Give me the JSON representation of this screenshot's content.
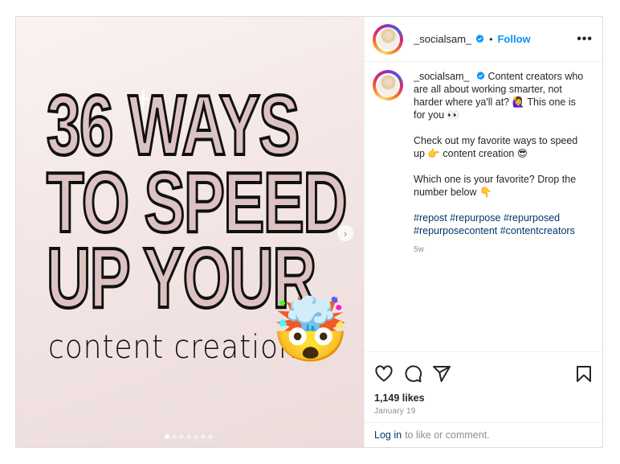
{
  "post": {
    "username": "_socialsam_",
    "verified": true,
    "separator": "•",
    "follow_label": "Follow",
    "more_label": "•••",
    "accent_color": "#0095f6",
    "hashtag_color": "#00376b"
  },
  "media": {
    "poster_lines": [
      "36 WAYS",
      "TO SPEED",
      "UP YOUR"
    ],
    "poster_script": "content creation",
    "poster_emoji": "🤯",
    "next_label": "›",
    "slide_count": 7,
    "active_slide": 1
  },
  "caption": {
    "username": "_socialsam_",
    "paragraphs": [
      "Content creators who are all about working smarter, not harder where ya'll at? 🙋‍♀️ This one is for you 👀",
      "Check out my favorite ways to speed up 👉 content creation 😎",
      "Which one is your favorite? Drop the number below 👇"
    ],
    "hashtags": [
      "#repost",
      "#repurpose",
      "#repurposed",
      "#repurposecontent",
      "#contentcreators"
    ],
    "age": "5w"
  },
  "actions": {
    "icons": [
      "heart-icon",
      "comment-icon",
      "share-icon",
      "bookmark-icon"
    ],
    "likes": "1,149 likes",
    "date": "January 19"
  },
  "login": {
    "link": "Log in",
    "text": "to like or comment."
  }
}
